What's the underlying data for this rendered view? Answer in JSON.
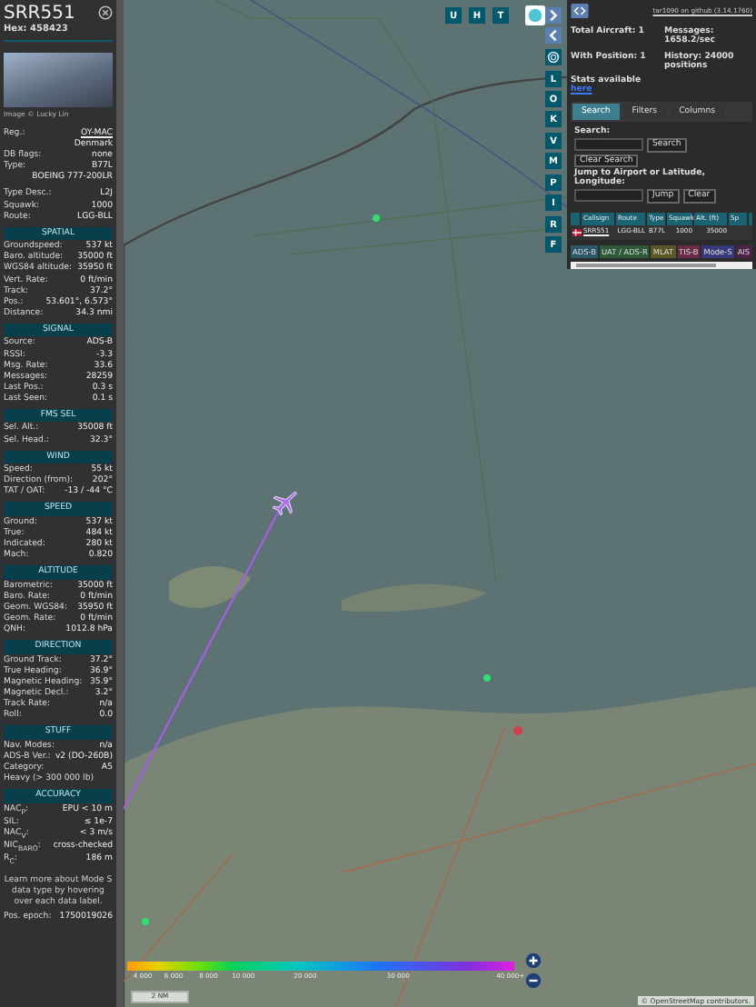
{
  "aircraft": {
    "callsign": "SRR551",
    "hex": "Hex: 458423",
    "photo_credit": "Image © Lucky Lin"
  },
  "details": [
    {
      "kind": "link",
      "label": "Reg.:",
      "value": "OY-MAC"
    },
    {
      "kind": "plain",
      "value": "Denmark"
    },
    {
      "kind": "plain",
      "label": "DB flags:",
      "value": "none"
    },
    {
      "kind": "plain",
      "label": "Type:",
      "value": "B77L"
    },
    {
      "kind": "plain",
      "value": "BOEING 777-200LR"
    },
    {
      "kind": "gap",
      "label": "Type Desc.:",
      "value": "L2J"
    },
    {
      "kind": "plain",
      "label": "Squawk:",
      "value": "1000"
    },
    {
      "kind": "plain",
      "label": "Route:",
      "value": "LGG-BLL"
    }
  ],
  "sections": [
    {
      "title": "SPATIAL",
      "rows": [
        {
          "label": "Groundspeed:",
          "value": "537 kt"
        },
        {
          "label": "Baro. altitude:",
          "value": "35000 ft"
        },
        {
          "label": "WGS84 altitude:",
          "value": "35950 ft"
        },
        {
          "label": "Vert. Rate:",
          "value": "0 ft/min"
        },
        {
          "label": "Track:",
          "value": "37.2°"
        },
        {
          "label": "Pos.:",
          "value": "53.601°, 6.573°"
        },
        {
          "label": "Distance:",
          "value": "34.3 nmi"
        }
      ]
    },
    {
      "title": "SIGNAL",
      "rows": [
        {
          "label": "Source:",
          "value": "ADS-B"
        },
        {
          "label": "RSSI:",
          "value": "-3.3"
        },
        {
          "label": "Msg. Rate:",
          "value": "33.6"
        },
        {
          "label": "Messages:",
          "value": "28259"
        },
        {
          "label": "Last Pos.:",
          "value": "0.3 s"
        },
        {
          "label": "Last Seen:",
          "value": "0.1 s"
        }
      ]
    },
    {
      "title": "FMS SEL",
      "rows": [
        {
          "label": "Sel. Alt.:",
          "value": "35008 ft"
        },
        {
          "label": "Sel. Head.:",
          "value": "32.3°"
        }
      ]
    },
    {
      "title": "WIND",
      "rows": [
        {
          "label": "Speed:",
          "value": "55 kt"
        },
        {
          "label": "Direction (from):",
          "value": "202°"
        },
        {
          "label": "TAT / OAT:",
          "value": "-13 / -44 °C"
        }
      ]
    },
    {
      "title": "SPEED",
      "rows": [
        {
          "label": "Ground:",
          "value": "537 kt"
        },
        {
          "label": "True:",
          "value": "484 kt"
        },
        {
          "label": "Indicated:",
          "value": "280 kt"
        },
        {
          "label": "Mach:",
          "value": "0.820"
        }
      ]
    },
    {
      "title": "ALTITUDE",
      "rows": [
        {
          "label": "Barometric:",
          "value": "35000 ft"
        },
        {
          "label": "Baro. Rate:",
          "value": "0 ft/min"
        },
        {
          "label": "Geom. WGS84:",
          "value": "35950 ft"
        },
        {
          "label": "Geom. Rate:",
          "value": "0 ft/min"
        },
        {
          "label": "QNH:",
          "value": "1012.8 hPa"
        }
      ]
    },
    {
      "title": "DIRECTION",
      "rows": [
        {
          "label": "Ground Track:",
          "value": "37.2°"
        },
        {
          "label": "True Heading:",
          "value": "36.9°"
        },
        {
          "label": "Magnetic Heading:",
          "value": "35.9°"
        },
        {
          "label": "Magnetic Decl.:",
          "value": "3.2°"
        },
        {
          "label": "Track Rate:",
          "value": "n/a"
        },
        {
          "label": "Roll:",
          "value": "0.0"
        }
      ]
    },
    {
      "title": "STUFF",
      "rows": [
        {
          "label": "Nav. Modes:",
          "value": "n/a"
        },
        {
          "label": "ADS-B Ver.:",
          "value": "v2 (DO-260B)"
        },
        {
          "label": "Category:",
          "value": "A5"
        },
        {
          "label": "Heavy (> 300 000 lb)"
        }
      ]
    },
    {
      "title": "ACCURACY",
      "rows": [
        {
          "label": "NAC$_{P}$:",
          "value": "EPU < 10 m"
        },
        {
          "label": "SIL:",
          "value": "≤ 1e-7"
        },
        {
          "label": "NAC$_{V}$:",
          "value": "< 3 m/s"
        },
        {
          "label": "NIC$_{BARO}$:",
          "value": "cross-checked"
        },
        {
          "label": "R$_{C}$:",
          "value": "186 m"
        }
      ]
    }
  ],
  "help_text": "Learn more about Mode S data type by hovering over each data label.",
  "epoch": {
    "label": "Pos. epoch:",
    "value": "1750019026"
  },
  "map": {
    "top_buttons": [
      "U",
      "H",
      "T"
    ],
    "side_buttons": [
      [
        {
          "kind": "chevron-right"
        },
        {
          "kind": "chevron-left"
        }
      ],
      [
        {
          "kind": "settings"
        }
      ],
      [
        {
          "kind": "letter",
          "label": "L"
        },
        {
          "kind": "letter",
          "label": "O"
        },
        {
          "kind": "letter",
          "label": "K"
        }
      ],
      [
        {
          "kind": "letter",
          "label": "V"
        },
        {
          "kind": "letter",
          "label": "M"
        }
      ],
      [
        {
          "kind": "letter",
          "label": "P"
        },
        {
          "kind": "letter",
          "label": "I"
        }
      ],
      [
        {
          "kind": "letter",
          "label": "R"
        },
        {
          "kind": "letter",
          "label": "F"
        }
      ]
    ],
    "legend_labels": [
      "4 000",
      "6 000",
      "8 000",
      "10 000",
      "20 000",
      "30 000",
      "40 000+"
    ],
    "scale": "2 NM",
    "attribution": "© OpenStreetMap contributors."
  },
  "panel": {
    "link": "tar1090 on github (3.14.1760)",
    "stats": [
      {
        "label": "Total Aircraft: 1"
      },
      {
        "label": "Messages: 1658.2/sec"
      },
      {
        "label": "With Position: 1"
      },
      {
        "label": "History: 24000 positions"
      }
    ],
    "stats_text": "Stats available",
    "stats_link": "here",
    "tabs": [
      {
        "label": "Search",
        "selected": true
      },
      {
        "label": "Filters",
        "selected": false
      },
      {
        "label": "Columns",
        "selected": false
      }
    ],
    "search_label": "Search:",
    "search_button": "Search",
    "clear_search_button": "Clear Search",
    "jump_label": "Jump to Airport or Latitude, Longitude:",
    "jump_button": "Jump",
    "clear_button": "Clear",
    "columns": [
      "Callsign",
      "Route",
      "Type",
      "Squawk",
      "Alt. (ft)",
      "Sp"
    ],
    "rows": [
      {
        "cells": [
          "SRR551",
          "LGG-BLL",
          "B77L",
          "1000",
          "35000"
        ]
      }
    ],
    "sources": [
      {
        "label": "ADS-B",
        "color": "#2c5868"
      },
      {
        "label": "UAT / ADS-R",
        "color": "#2e5a3a"
      },
      {
        "label": "MLAT",
        "color": "#5a5626"
      },
      {
        "label": "TIS-B",
        "color": "#6b2a45"
      },
      {
        "label": "Mode-S",
        "color": "#373a7a"
      },
      {
        "label": "AIS",
        "color": "#4a2446"
      }
    ]
  }
}
